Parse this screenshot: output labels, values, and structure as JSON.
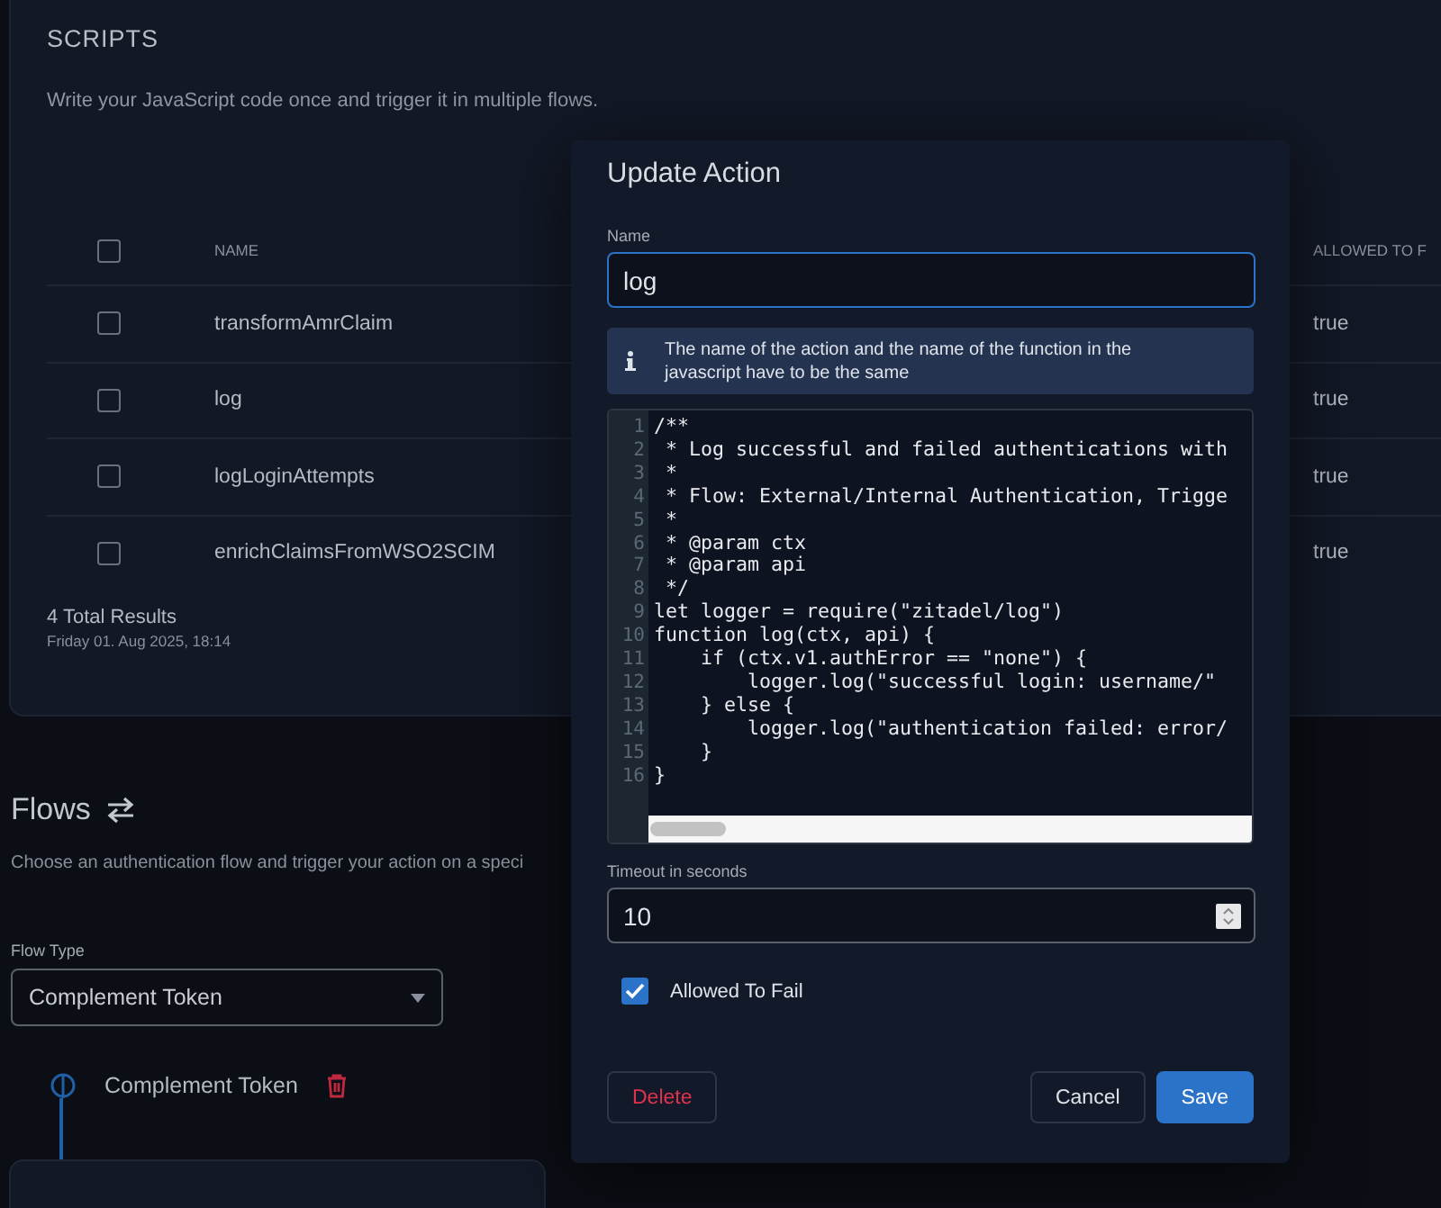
{
  "scripts": {
    "title": "SCRIPTS",
    "description": "Write your JavaScript code once and trigger it in multiple flows.",
    "table": {
      "header_checked": false,
      "columns": [
        "NAME",
        "ALLOWED TO F"
      ],
      "rows": [
        {
          "checked": false,
          "name": "transformAmrClaim",
          "allowed_to_fail": "true"
        },
        {
          "checked": false,
          "name": "log",
          "allowed_to_fail": "true"
        },
        {
          "checked": false,
          "name": "logLoginAttempts",
          "allowed_to_fail": "true"
        },
        {
          "checked": false,
          "name": "enrichClaimsFromWSO2SCIM",
          "allowed_to_fail": "true"
        }
      ]
    },
    "total": "4 Total Results",
    "timestamp": "Friday 01. Aug 2025, 18:14"
  },
  "flows": {
    "title": "Flows",
    "description": "Choose an authentication flow and trigger your action on a speci",
    "flow_type": {
      "label": "Flow Type",
      "value": "Complement Token"
    },
    "steps": [
      {
        "name": "Complement Token"
      }
    ]
  },
  "dialog": {
    "title": "Update Action",
    "name_label": "Name",
    "name_value": "log",
    "info": "The name of the action and the name of the function in the javascript have to be the same",
    "code": [
      {
        "number": "1",
        "text": "/**"
      },
      {
        "number": "2",
        "text": " * Log successful and failed authentications with"
      },
      {
        "number": "3",
        "text": " *"
      },
      {
        "number": "4",
        "text": " * Flow: External/Internal Authentication, Trigge"
      },
      {
        "number": "5",
        "text": " *"
      },
      {
        "number": "6",
        "text": " * @param ctx"
      },
      {
        "number": "7",
        "text": " * @param api"
      },
      {
        "number": "8",
        "text": " */"
      },
      {
        "number": "9",
        "text": "let logger = require(\"zitadel/log\")"
      },
      {
        "number": "10",
        "text": "function log(ctx, api) {"
      },
      {
        "number": "11",
        "text": "    if (ctx.v1.authError == \"none\") {"
      },
      {
        "number": "12",
        "text": "        logger.log(\"successful login: username/\""
      },
      {
        "number": "13",
        "text": "    } else {"
      },
      {
        "number": "14",
        "text": "        logger.log(\"authentication failed: error/"
      },
      {
        "number": "15",
        "text": "    }"
      },
      {
        "number": "16",
        "text": "}"
      }
    ],
    "timeout_label": "Timeout in seconds",
    "timeout_value": "10",
    "allowed_to_fail": {
      "label": "Allowed To Fail",
      "checked": true
    },
    "buttons": [
      {
        "kind": "danger",
        "label": "Delete"
      },
      {
        "kind": "neutral",
        "label": "Cancel"
      },
      {
        "kind": "primary",
        "label": "Save"
      }
    ]
  }
}
